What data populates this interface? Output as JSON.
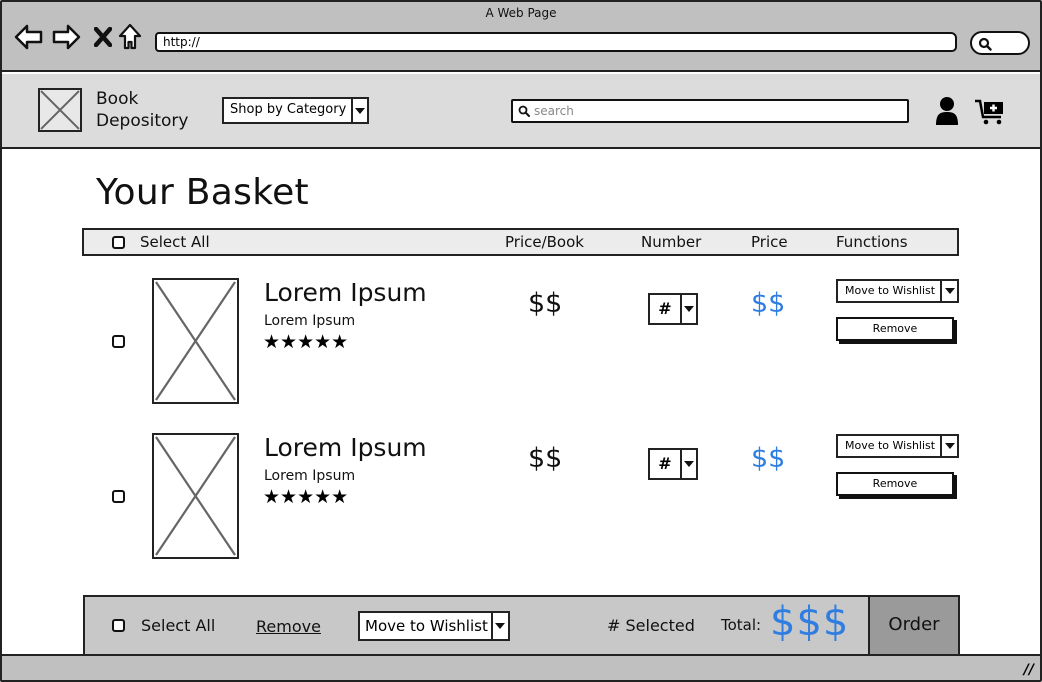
{
  "browser": {
    "window_title": "A Web Page",
    "url": "http://",
    "nav_icons": [
      "back-arrow-icon",
      "forward-arrow-icon",
      "close-icon",
      "home-icon"
    ],
    "search_icon": "search-icon"
  },
  "header": {
    "logo_icon": "image-placeholder-icon",
    "brand_line1": "Book",
    "brand_line2": "Depository",
    "category_select": "Shop by Category",
    "search_placeholder": "search",
    "user_icon": "user-icon",
    "cart_icon": "add-to-cart-icon"
  },
  "main": {
    "title": "Your Basket",
    "table_header": {
      "select_all": "Select All",
      "price_per_book": "Price/Book",
      "number": "Number",
      "price": "Price",
      "functions": "Functions"
    },
    "items": [
      {
        "title": "Lorem Ipsum",
        "author": "Lorem Ipsum",
        "rating": 5,
        "rating_max": 5,
        "stars": "★★★★★",
        "unit_price": "$$",
        "quantity": "#",
        "line_price": "$$",
        "wishlist_select": "Move to Wishlist",
        "remove_label": "Remove"
      },
      {
        "title": "Lorem Ipsum",
        "author": "Lorem Ipsum",
        "rating": 5,
        "rating_max": 5,
        "stars": "★★★★★",
        "unit_price": "$$",
        "quantity": "#",
        "line_price": "$$",
        "wishlist_select": "Move to Wishlist",
        "remove_label": "Remove"
      }
    ]
  },
  "footer_bar": {
    "select_all": "Select All",
    "remove_link": "Remove",
    "wishlist_select": "Move to Wishlist",
    "selected_count": "# Selected",
    "total_label": "Total:",
    "total_value": "$$$",
    "order_button": "Order"
  },
  "colors": {
    "accent_price": "#2f7de1",
    "chrome_bg": "#c0c0c0",
    "header_bg": "#dcdcdc",
    "order_button_bg": "#9a9a9a"
  }
}
